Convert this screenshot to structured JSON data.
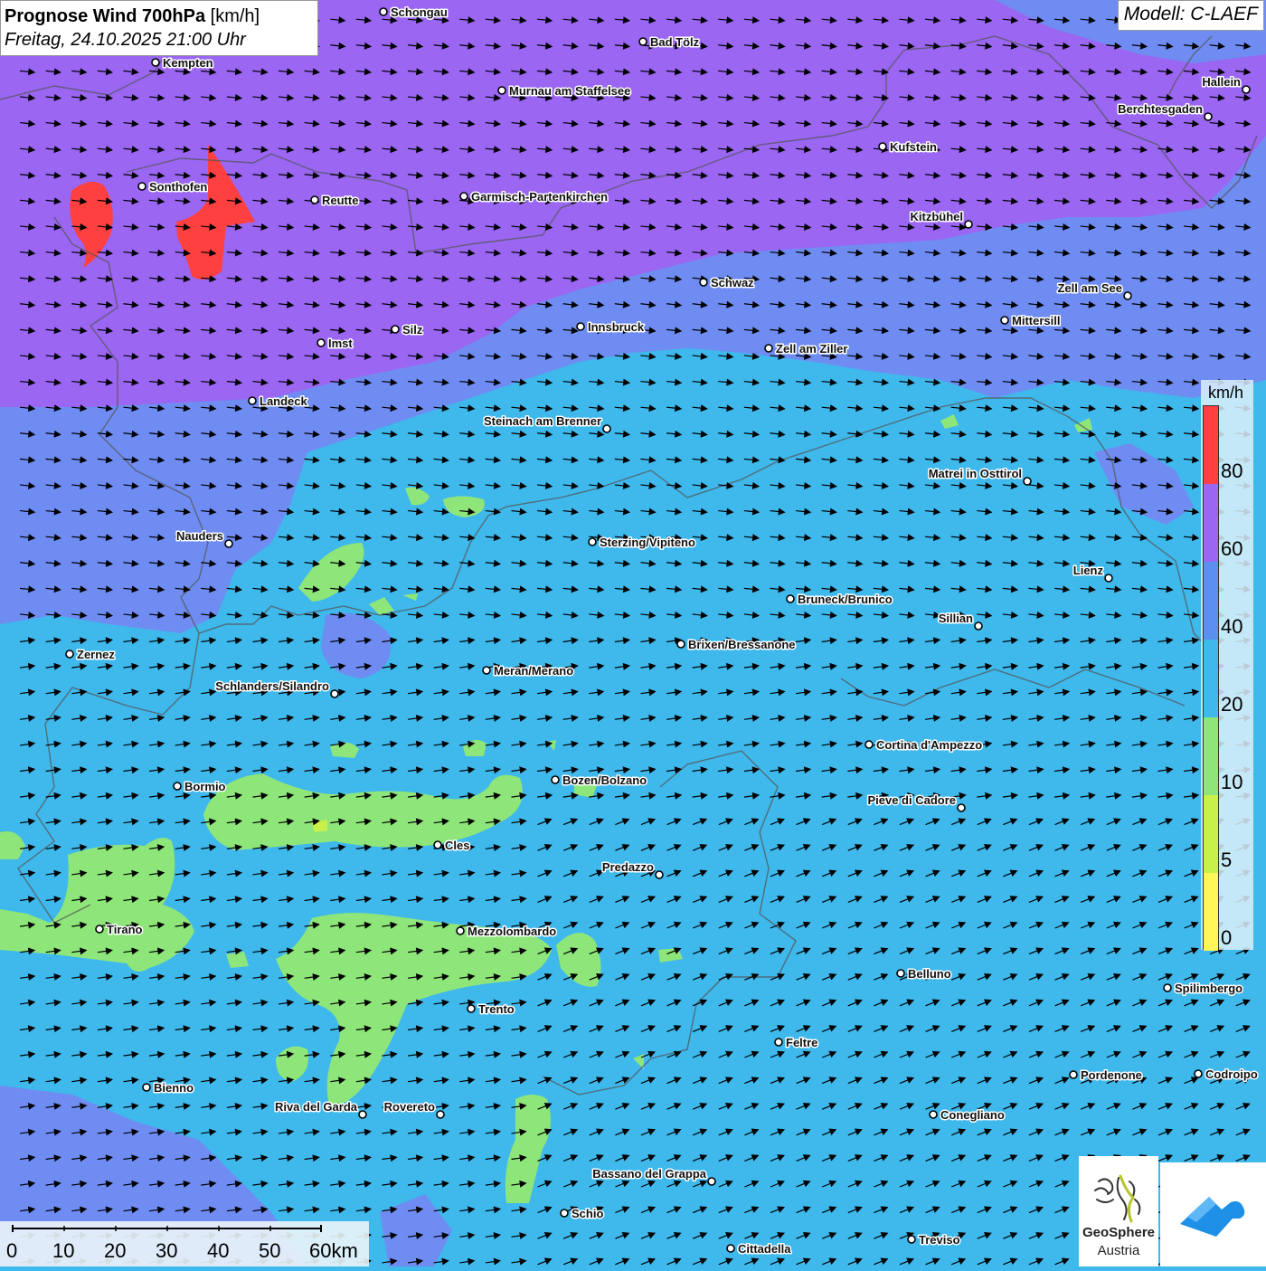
{
  "header": {
    "title": "Prognose Wind 700hPa",
    "unit": "[km/h]",
    "datetime": "Freitag, 24.10.2025 21:00 Uhr",
    "model": "Modell: C-LAEF"
  },
  "legend": {
    "unit": "km/h",
    "labels": [
      "80",
      "60",
      "40",
      "20",
      "10",
      "5",
      "0"
    ],
    "colors": [
      "#ff4040",
      "#9a66f2",
      "#5b8ff0",
      "#3fb8ec",
      "#8ee67a",
      "#c8f04a",
      "#fff65a"
    ]
  },
  "scalebar": {
    "labels": [
      "0",
      "10",
      "20",
      "30",
      "40",
      "50",
      "60km"
    ]
  },
  "logo": {
    "name": "GeoSphere",
    "sub": "Austria"
  },
  "map": {
    "wind_field_colors": {
      "over_60": "#9a66f2",
      "40_to_60": "#6f8cf2",
      "20_to_40": "#3fb8ec",
      "10_to_20": "#8ee67a",
      "5_to_10": "#c8f04a",
      "over_80": "#ff4040"
    },
    "wind_direction": "westerly to south-westerly flow",
    "cities": [
      {
        "name": "Schongau"
      },
      {
        "name": "Bad Tölz"
      },
      {
        "name": "Kempten"
      },
      {
        "name": "Murnau am Staffelsee"
      },
      {
        "name": "Hallein"
      },
      {
        "name": "Berchtesgaden"
      },
      {
        "name": "Kufstein"
      },
      {
        "name": "Sonthofen"
      },
      {
        "name": "Reutte"
      },
      {
        "name": "Garmisch-Partenkirchen"
      },
      {
        "name": "Kitzbühel"
      },
      {
        "name": "Schwaz"
      },
      {
        "name": "Zell am See"
      },
      {
        "name": "Mittersill"
      },
      {
        "name": "Innsbruck"
      },
      {
        "name": "Silz"
      },
      {
        "name": "Imst"
      },
      {
        "name": "Zell am Ziller"
      },
      {
        "name": "Landeck"
      },
      {
        "name": "Steinach am Brenner"
      },
      {
        "name": "Matrei in Osttirol"
      },
      {
        "name": "Nauders"
      },
      {
        "name": "Sterzing/Vipiteno"
      },
      {
        "name": "Lienz"
      },
      {
        "name": "Bruneck/Brunico"
      },
      {
        "name": "Sillian"
      },
      {
        "name": "Brixen/Bressanone"
      },
      {
        "name": "Zernez"
      },
      {
        "name": "Meran/Merano"
      },
      {
        "name": "Schlanders/Silandro"
      },
      {
        "name": "Cortina d'Ampezzo"
      },
      {
        "name": "Bormio"
      },
      {
        "name": "Bozen/Bolzano"
      },
      {
        "name": "Pieve di Cadore"
      },
      {
        "name": "Cles"
      },
      {
        "name": "Predazzo"
      },
      {
        "name": "Tirano"
      },
      {
        "name": "Mezzolombardo"
      },
      {
        "name": "Belluno"
      },
      {
        "name": "Spilimbergo"
      },
      {
        "name": "Trento"
      },
      {
        "name": "Feltre"
      },
      {
        "name": "Bienno"
      },
      {
        "name": "Pordenone"
      },
      {
        "name": "Codroipo"
      },
      {
        "name": "Riva del Garda"
      },
      {
        "name": "Rovereto"
      },
      {
        "name": "Conegliano"
      },
      {
        "name": "Bassano del Grappa"
      },
      {
        "name": "Schio"
      },
      {
        "name": "Treviso"
      },
      {
        "name": "Cittadella"
      }
    ]
  }
}
